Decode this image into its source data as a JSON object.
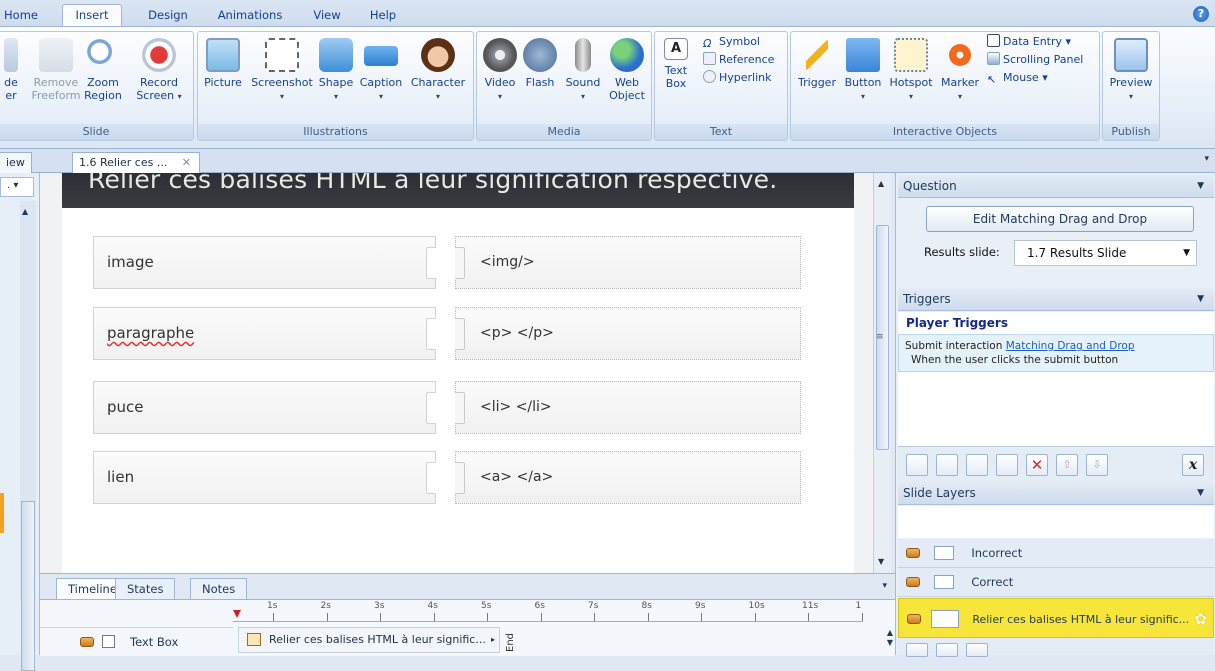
{
  "ribbon_tabs": [
    "Home",
    "Insert",
    "Design",
    "Animations",
    "View",
    "Help"
  ],
  "ribbon_groups": {
    "slide": {
      "label": "Slide",
      "buttons": [
        "Remove Freeform",
        "Zoom Region",
        "Record Screen"
      ],
      "cut_text_1": "de",
      "cut_text_2": "er"
    },
    "illustrations": {
      "label": "Illustrations",
      "buttons": [
        "Picture",
        "Screenshot",
        "Shape",
        "Caption",
        "Character"
      ]
    },
    "media": {
      "label": "Media",
      "buttons": [
        "Video",
        "Flash",
        "Sound",
        "Web Object"
      ]
    },
    "text": {
      "label": "Text",
      "text_box": "Text Box",
      "symbol": "Symbol",
      "reference": "Reference",
      "hyperlink": "Hyperlink"
    },
    "interactive": {
      "label": "Interactive Objects",
      "buttons": [
        "Trigger",
        "Button",
        "Hotspot",
        "Marker"
      ],
      "data_entry": "Data Entry",
      "scrolling_panel": "Scrolling Panel",
      "mouse": "Mouse"
    },
    "publish": {
      "label": "Publish",
      "preview": "Preview"
    }
  },
  "doc_tabs": {
    "left_cut": "iew",
    "active": "1.6 Relier ces ..."
  },
  "slide": {
    "title": "Relier ces balises HTML à leur signification respective.",
    "pairs": [
      {
        "left": "image",
        "right": "<img/>"
      },
      {
        "left": "paragraphe",
        "right": "<p> </p>"
      },
      {
        "left": "puce",
        "right": "<li> </li>"
      },
      {
        "left": "lien",
        "right": "<a> </a>"
      }
    ]
  },
  "timeline": {
    "tabs": [
      "Timeline",
      "States",
      "Notes"
    ],
    "ticks": [
      "1s",
      "2s",
      "3s",
      "4s",
      "5s",
      "6s",
      "7s",
      "8s",
      "9s",
      "10s",
      "11s",
      "1"
    ],
    "row_label": "Text Box",
    "row_bar": "Relier ces balises HTML à leur signific...",
    "end_label": "End"
  },
  "question_panel": {
    "header": "Question",
    "edit_button": "Edit Matching Drag and Drop",
    "results_label": "Results slide:",
    "results_value": "1.7 Results Slide"
  },
  "triggers_panel": {
    "header": "Triggers",
    "section": "Player Triggers",
    "trigger_action": "Submit interaction",
    "trigger_link": "Matching Drag and Drop",
    "trigger_when": "When the user clicks the submit button",
    "x_label": "x"
  },
  "layers_panel": {
    "header": "Slide Layers",
    "layers": [
      "Incorrect",
      "Correct",
      "Relier ces balises HTML à leur signific..."
    ]
  },
  "colors": {
    "accent": "#1e395b",
    "selected_layer": "#f8e53a",
    "title_bar": "#2e3035"
  }
}
